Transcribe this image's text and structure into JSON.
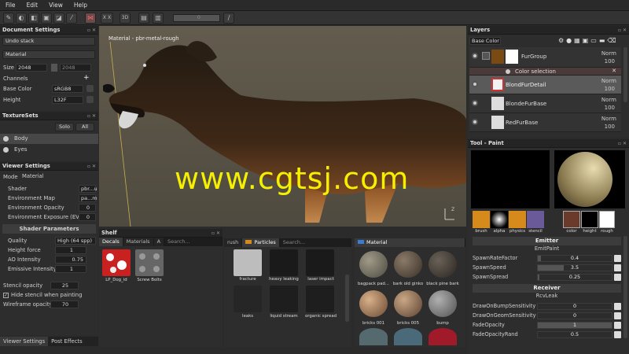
{
  "menu": [
    "File",
    "Edit",
    "View",
    "Help"
  ],
  "toolbar": {
    "axis_label": "X X",
    "sym_label": "3D",
    "btn2": "2D",
    "zoom_value": "0"
  },
  "doc_settings": {
    "title": "Document Settings",
    "undo": "Undo stack",
    "material": "Material",
    "size_label": "Size",
    "size_value": "2048",
    "size_value2": "2048",
    "channels": "Channels",
    "base_color_label": "Base Color",
    "base_color_value": "sRGB8",
    "height_label": "Height",
    "height_value": "L32F"
  },
  "texturesets": {
    "title": "TextureSets",
    "solo": "Solo",
    "all": "All",
    "items": [
      "Body",
      "Eyes"
    ]
  },
  "viewer": {
    "title": "Viewer Settings",
    "mode_label": "Mode",
    "mode_value": "Material",
    "shader_label": "Shader",
    "shader_value": "pbr...u",
    "envmap_label": "Environment Map",
    "envmap_value": "pa...m",
    "envop_label": "Environment Opacity",
    "envop_value": "0",
    "envexp_label": "Environment Exposure (EV)",
    "envexp_value": "0",
    "shader_params": "Shader Parameters",
    "quality_label": "Quality",
    "quality_value": "High (64 spp)",
    "height_label": "Height force",
    "height_value": "1",
    "ao_label": "AO Intensity",
    "ao_value": "0.75",
    "emissive_label": "Emissive Intensity",
    "emissive_value": "1",
    "stencil_label": "Stencil opacity",
    "stencil_value": "25",
    "hide_stencil": "Hide stencil when painting",
    "wire_label": "Wireframe opacity",
    "wire_value": "70"
  },
  "bottom_tabs": [
    "Viewer Settings",
    "Post Effects"
  ],
  "viewport": {
    "label": "Material - pbr-metal-rough",
    "watermark": "www.cgtsj.com"
  },
  "shelf": {
    "title": "Shelf",
    "tabs": [
      "Decals",
      "Materials",
      "A"
    ],
    "search": "Search...",
    "decals": [
      "LP_Dog_id",
      "Screw Bolts"
    ],
    "brush_tab": "rush",
    "particles_tab": "Particles",
    "particles": [
      "fracture",
      "heavy leaking",
      "laser impact",
      "leaks",
      "liquid stream",
      "organic spread"
    ],
    "material_tab": "Material",
    "materials": [
      "bagpack pad...",
      "bark old ginko",
      "black pine bark",
      "bricks 001",
      "bricks 005",
      "bump"
    ]
  },
  "layers": {
    "title": "Layers",
    "channel": "Base Color",
    "items": [
      {
        "name": "FurGroup",
        "blend": "Norm",
        "opacity": "100"
      },
      {
        "name": "Color selection",
        "blend": "",
        "opacity": ""
      },
      {
        "name": "BlondFurDetail",
        "blend": "Norm",
        "opacity": "100"
      },
      {
        "name": "BlondeFurBase",
        "blend": "Norm",
        "opacity": "100"
      },
      {
        "name": "RedFurBase",
        "blend": "Norm",
        "opacity": "100"
      }
    ]
  },
  "tool": {
    "title": "Tool - Paint",
    "slots": [
      "brush",
      "alpha",
      "physics",
      "stencil",
      "color",
      "height",
      "rough"
    ],
    "emitter_title": "Emitter",
    "emitter_sub": "EmitPaint",
    "emitter_props": [
      {
        "label": "SpawnRateFactor",
        "value": "0.4",
        "level": 0.04
      },
      {
        "label": "SpawnSpeed",
        "value": "3.5",
        "level": 0.35
      },
      {
        "label": "SpawnSpread",
        "value": "0.25",
        "level": 0.02
      }
    ],
    "receiver_title": "Receiver",
    "receiver_sub": "RcvLeak",
    "receiver_props": [
      {
        "label": "DrawOnBumpSensitivity",
        "value": "0"
      },
      {
        "label": "DrawOnGeomSensitivity",
        "value": "0"
      },
      {
        "label": "FadeOpacity",
        "value": "1"
      },
      {
        "label": "FadeOpacityRand",
        "value": "0.5"
      }
    ]
  },
  "colors": {
    "accent_watermark": "#f5f000",
    "panel": "#2d2d2d",
    "viewport_bg": "#5b5446"
  }
}
